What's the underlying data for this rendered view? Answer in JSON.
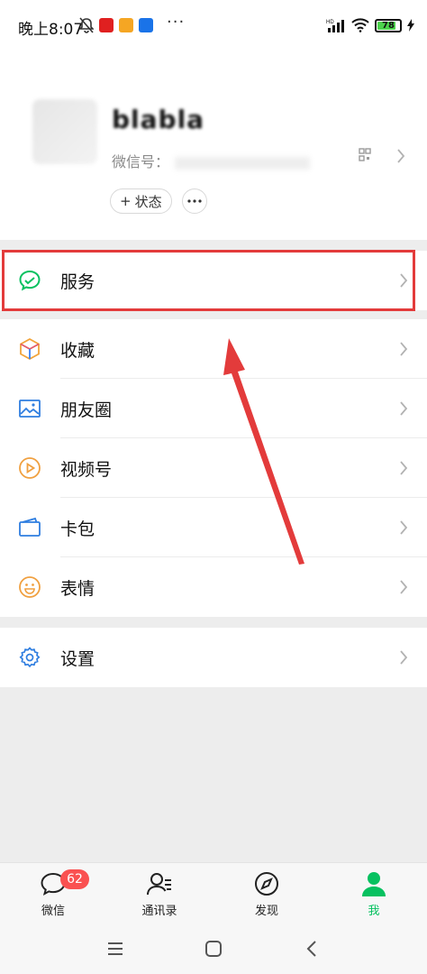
{
  "status_bar": {
    "time": "晚上8:07",
    "dots": "···",
    "battery": "78",
    "battery_level": 0.78,
    "network_label": "HD"
  },
  "profile": {
    "nickname": "blabla",
    "wechat_id_label": "微信号：",
    "status_button": "状态",
    "status_plus": "+"
  },
  "menu": {
    "service": "服务",
    "favorites": "收藏",
    "moments": "朋友圈",
    "channels": "视频号",
    "cards": "卡包",
    "stickers": "表情",
    "settings": "设置"
  },
  "tabs": {
    "chats": "微信",
    "chats_badge": "62",
    "contacts": "通讯录",
    "discover": "发现",
    "me": "我"
  },
  "colors": {
    "accent": "#07c160",
    "badge": "#fa5151",
    "highlight": "#e33b3b"
  }
}
